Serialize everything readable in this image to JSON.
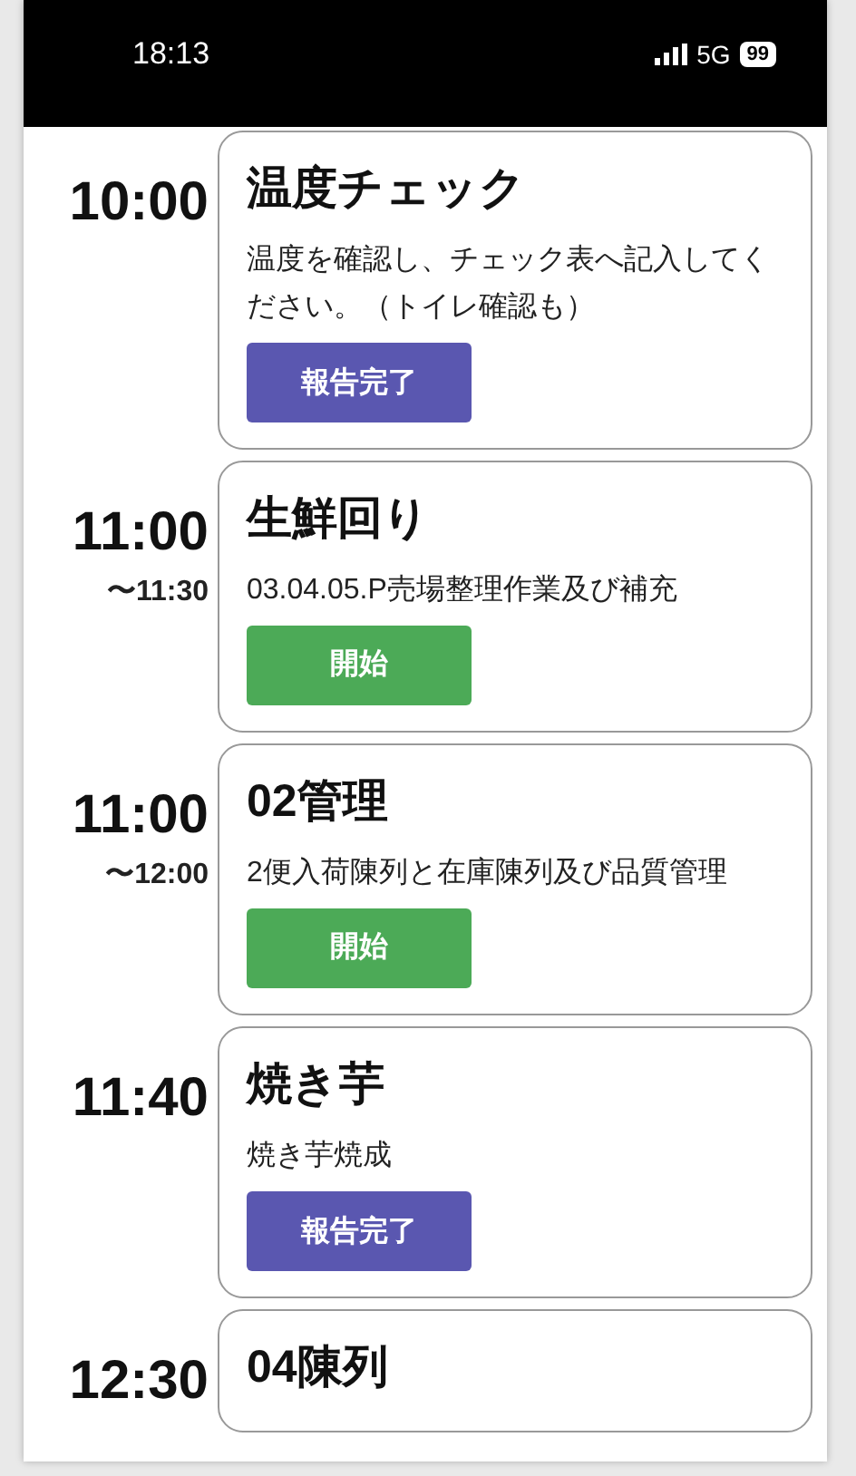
{
  "status_bar": {
    "time": "18:13",
    "network": "5G",
    "battery": "99"
  },
  "tasks": [
    {
      "start": "10:00",
      "title": "温度チェック",
      "description": "温度を確認し、チェック表へ記入してください。（トイレ確認も）",
      "button": {
        "label": "報告完了",
        "kind": "report"
      }
    },
    {
      "start": "11:00",
      "end": "〜11:30",
      "title": "生鮮回り",
      "description": "03.04.05.P売場整理作業及び補充",
      "button": {
        "label": "開始",
        "kind": "start"
      }
    },
    {
      "start": "11:00",
      "end": "〜12:00",
      "title": "02管理",
      "description": "2便入荷陳列と在庫陳列及び品質管理",
      "button": {
        "label": "開始",
        "kind": "start"
      }
    },
    {
      "start": "11:40",
      "title": "焼き芋",
      "description": "焼き芋焼成",
      "button": {
        "label": "報告完了",
        "kind": "report"
      }
    },
    {
      "start": "12:30",
      "title": "04陳列"
    }
  ]
}
